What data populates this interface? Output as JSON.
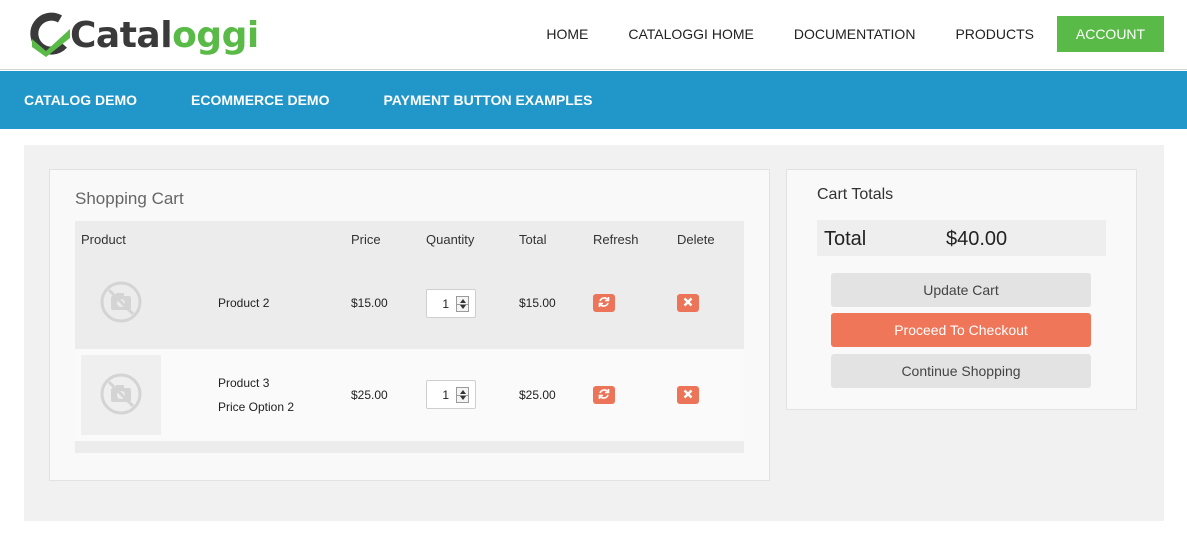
{
  "header": {
    "logo": {
      "text_dark": "Catal",
      "text_green": "oggi"
    },
    "nav": [
      "HOME",
      "CATALOGGI HOME",
      "DOCUMENTATION",
      "PRODUCTS"
    ],
    "account_label": "ACCOUNT"
  },
  "subnav": [
    "CATALOG DEMO",
    "ECOMMERCE DEMO",
    "PAYMENT BUTTON EXAMPLES"
  ],
  "cart": {
    "title": "Shopping Cart",
    "columns": {
      "product": "Product",
      "price": "Price",
      "quantity": "Quantity",
      "total": "Total",
      "refresh": "Refresh",
      "delete": "Delete"
    },
    "rows": [
      {
        "name": "Product 2",
        "option": "",
        "price": "$15.00",
        "quantity": "1",
        "total": "$15.00"
      },
      {
        "name": "Product 3",
        "option": "Price Option 2",
        "price": "$25.00",
        "quantity": "1",
        "total": "$25.00"
      }
    ]
  },
  "totals": {
    "title": "Cart Totals",
    "total_label": "Total",
    "total_value": "$40.00",
    "update_label": "Update Cart",
    "checkout_label": "Proceed To Checkout",
    "continue_label": "Continue Shopping"
  },
  "colors": {
    "brand_green": "#5aba47",
    "nav_blue": "#2096c9",
    "accent_orange": "#ef7658"
  },
  "icons": [
    "logo-arrow-icon",
    "no-image-icon",
    "refresh-icon",
    "delete-icon",
    "spinner-icon"
  ]
}
